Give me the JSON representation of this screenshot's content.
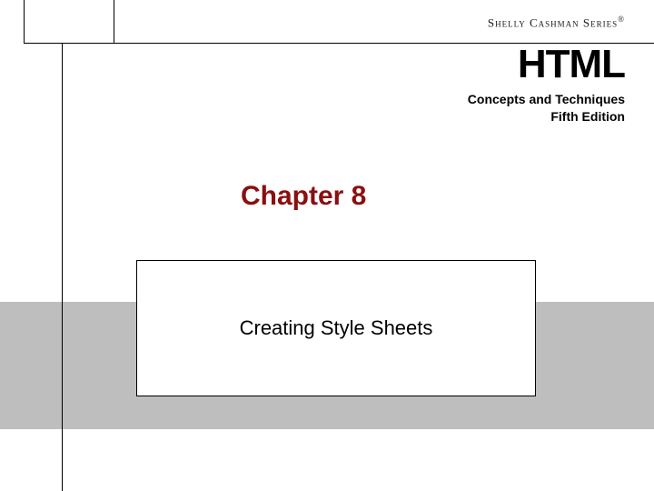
{
  "series": {
    "name": "Shelly Cashman Series",
    "trademark": "®"
  },
  "book": {
    "title": "HTML",
    "subtitle_line1": "Concepts and Techniques",
    "subtitle_line2": "Fifth Edition"
  },
  "chapter": {
    "label": "Chapter 8",
    "topic": "Creating Style Sheets"
  },
  "colors": {
    "accent": "#8a0f0f",
    "band": "#bebebe"
  }
}
